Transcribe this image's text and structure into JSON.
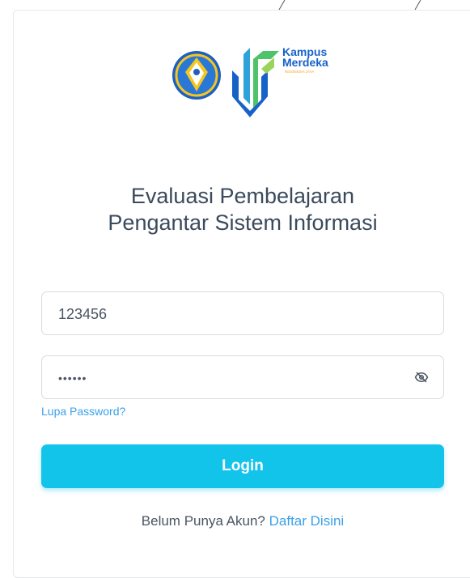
{
  "header": {
    "logo_left_name": "Tut Wuri Handayani",
    "logo_right_text_1": "Kampus",
    "logo_right_text_2": "Merdeka",
    "logo_right_text_3": "INDONESIA JAYA"
  },
  "title": {
    "line1": "Evaluasi Pembelajaran",
    "line2": "Pengantar Sistem Informasi"
  },
  "form": {
    "username_value": "123456",
    "password_value": "••••••",
    "forgot_label": "Lupa Password?",
    "login_label": "Login",
    "register_prompt": "Belum Punya Akun?",
    "register_link": "Daftar Disini"
  },
  "colors": {
    "primary": "#13c4ea",
    "link": "#3ba1e8",
    "title_text": "#3b4a5c",
    "border": "#d7dbe0"
  },
  "icons": {
    "password_toggle": "eye-off-icon"
  }
}
